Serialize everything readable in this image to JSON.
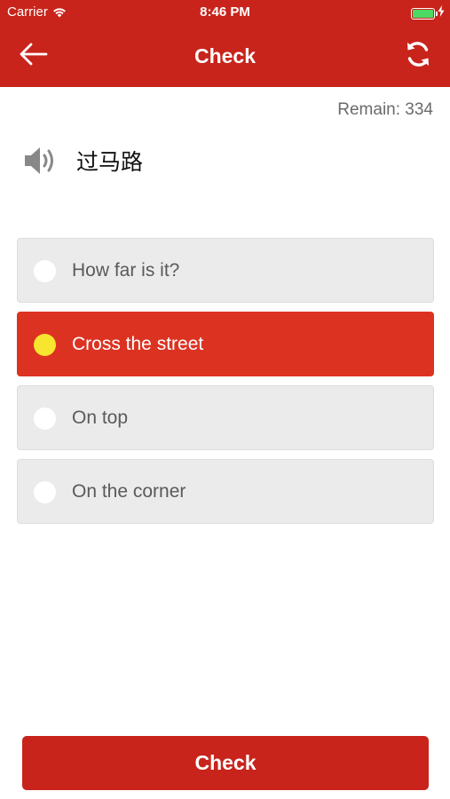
{
  "status_bar": {
    "carrier": "Carrier",
    "time": "8:46 PM",
    "battery_level": 1.0,
    "battery_color": "#4cd964"
  },
  "nav": {
    "title": "Check",
    "back_icon": "arrow-left-icon",
    "refresh_icon": "refresh-icon"
  },
  "remain": "Remain: 334",
  "question": {
    "speaker_icon": "speaker-icon",
    "text": "过马路"
  },
  "options": [
    {
      "label": "How far is it?",
      "selected": false
    },
    {
      "label": "Cross the street",
      "selected": true
    },
    {
      "label": "On top",
      "selected": false
    },
    {
      "label": "On the corner",
      "selected": false
    }
  ],
  "check_button": {
    "label": "Check"
  },
  "colors": {
    "brand": "#c8241b",
    "selected_option": "#dc3222",
    "selected_radio": "#f8e52f",
    "option_background": "#ebebeb"
  }
}
